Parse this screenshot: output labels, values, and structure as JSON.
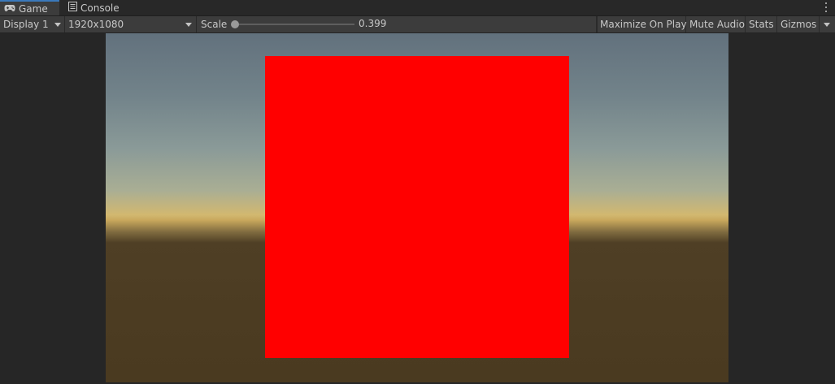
{
  "tabs": {
    "game": {
      "label": "Game",
      "icon": "gamepad-icon"
    },
    "console": {
      "label": "Console",
      "icon": "console-icon"
    }
  },
  "toolbar": {
    "display": "Display 1",
    "resolution": "1920x1080",
    "scale_label": "Scale",
    "scale_value": "0.399",
    "scale_level": 0.0,
    "maximize_on_play": "Maximize On Play",
    "mute_audio": "Mute Audio",
    "stats": "Stats",
    "gizmos": "Gizmos"
  },
  "colors": {
    "active_tab_accent": "#3a79bb",
    "rendered_object": "#ff0000"
  }
}
